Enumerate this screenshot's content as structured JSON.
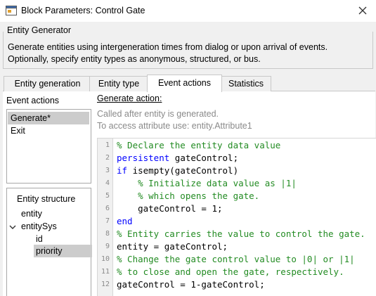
{
  "window": {
    "title": "Block Parameters: Control Gate",
    "close_icon": "close-icon",
    "app_icon": "simulink-block-icon"
  },
  "group": {
    "title": "Entity Generator",
    "description_line1": "Generate entities using intergeneration times from dialog or upon arrival of events.",
    "description_line2": "Optionally, specify entity types as anonymous, structured, or bus."
  },
  "tabs": [
    {
      "label": "Entity generation",
      "active": false
    },
    {
      "label": "Entity type",
      "active": false
    },
    {
      "label": "Event actions",
      "active": true
    },
    {
      "label": "Statistics",
      "active": false
    }
  ],
  "event_actions": {
    "label": "Event actions",
    "items": [
      {
        "label": "Generate*",
        "selected": true
      },
      {
        "label": "Exit",
        "selected": false
      }
    ]
  },
  "entity_structure": {
    "title": "Entity structure",
    "items": [
      {
        "label": "entity"
      },
      {
        "label": "entitySys",
        "expanded": true
      },
      {
        "label": "id"
      },
      {
        "label": "priority",
        "selected": true
      }
    ]
  },
  "generate_action": {
    "label": "Generate action:",
    "hint1": "Called after entity is generated.",
    "hint2": "To access attribute use: entity.Attribute1"
  },
  "code": [
    {
      "n": "1",
      "parts": [
        {
          "t": "% Declare the entity data value",
          "c": "cmt"
        }
      ]
    },
    {
      "n": "2",
      "parts": [
        {
          "t": "persistent",
          "c": "kw"
        },
        {
          "t": " gateControl;",
          "c": ""
        }
      ]
    },
    {
      "n": "3",
      "parts": [
        {
          "t": "if",
          "c": "kw"
        },
        {
          "t": " isempty(gateControl)",
          "c": ""
        }
      ]
    },
    {
      "n": "4",
      "parts": [
        {
          "t": "    % Initialize data value as |1|",
          "c": "cmt"
        }
      ]
    },
    {
      "n": "5",
      "parts": [
        {
          "t": "    % which opens the gate.",
          "c": "cmt"
        }
      ]
    },
    {
      "n": "6",
      "parts": [
        {
          "t": "    gateControl = 1;",
          "c": ""
        }
      ]
    },
    {
      "n": "7",
      "parts": [
        {
          "t": "end",
          "c": "kw"
        }
      ]
    },
    {
      "n": "8",
      "parts": [
        {
          "t": "% Entity carries the value to control the gate.",
          "c": "cmt"
        }
      ]
    },
    {
      "n": "9",
      "parts": [
        {
          "t": "entity = gateControl;",
          "c": ""
        }
      ]
    },
    {
      "n": "10",
      "parts": [
        {
          "t": "% Change the gate control value to |0| or |1|",
          "c": "cmt"
        }
      ]
    },
    {
      "n": "11",
      "parts": [
        {
          "t": "% to close and open the gate, respectively.",
          "c": "cmt"
        }
      ]
    },
    {
      "n": "12",
      "parts": [
        {
          "t": "gateControl = 1-gateControl;",
          "c": ""
        }
      ]
    }
  ],
  "colors": {
    "comment": "#228b22",
    "keyword": "#0000ff",
    "selection": "#cccccc",
    "panel_bg": "#f0f0f0"
  }
}
